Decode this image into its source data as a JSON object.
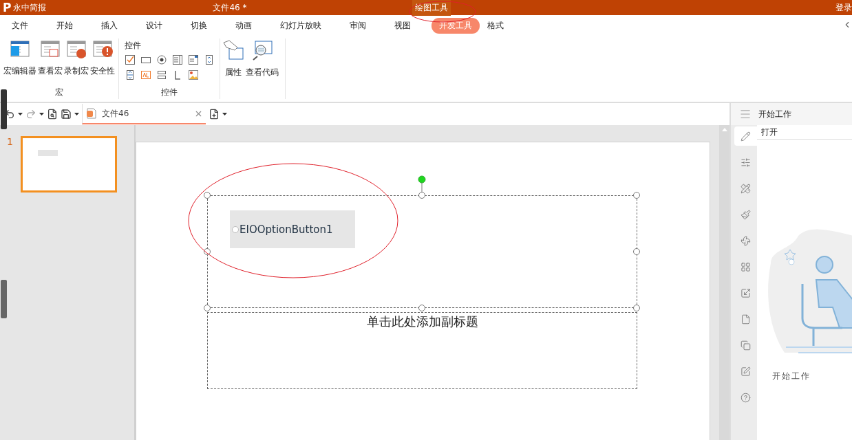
{
  "title_bar": {
    "logo": "P",
    "app_name": "永中简报",
    "document_title": "文件46 *",
    "context_tab": "绘图工具",
    "login": "登录"
  },
  "menu_tabs": [
    {
      "label": "文件",
      "selected": false
    },
    {
      "label": "开始",
      "selected": false
    },
    {
      "label": "插入",
      "selected": false
    },
    {
      "label": "设计",
      "selected": false
    },
    {
      "label": "切换",
      "selected": false
    },
    {
      "label": "动画",
      "selected": false
    },
    {
      "label": "幻灯片放映",
      "selected": false
    },
    {
      "label": "审阅",
      "selected": false
    },
    {
      "label": "视图",
      "selected": false
    },
    {
      "label": "开发工具",
      "selected": true
    },
    {
      "label": "格式",
      "selected": false
    }
  ],
  "ribbon": {
    "macro_group": {
      "label": "宏",
      "buttons": [
        "宏编辑器",
        "查看宏",
        "录制宏",
        "安全性"
      ]
    },
    "controls_group": {
      "title": "控件",
      "label": "控件"
    },
    "code_group": {
      "buttons": [
        "属性",
        "查看代码"
      ]
    }
  },
  "toolbar": {
    "document_tab": "文件46"
  },
  "slides": [
    {
      "number": "1",
      "selected": true
    }
  ],
  "slide": {
    "option_button": {
      "label": "EIOOptionButton1",
      "selected": false
    },
    "subtitle_placeholder": "单击此处添加副标题"
  },
  "task_pane": {
    "header": "开始工作",
    "item": "打开",
    "caption": "开始工作",
    "tabs": [
      {
        "selected": true
      },
      {
        "selected": false
      },
      {
        "selected": false
      },
      {
        "selected": false
      },
      {
        "selected": false
      },
      {
        "selected": false
      },
      {
        "selected": false
      },
      {
        "selected": false
      },
      {
        "selected": false
      },
      {
        "selected": false
      },
      {
        "selected": false
      }
    ]
  }
}
